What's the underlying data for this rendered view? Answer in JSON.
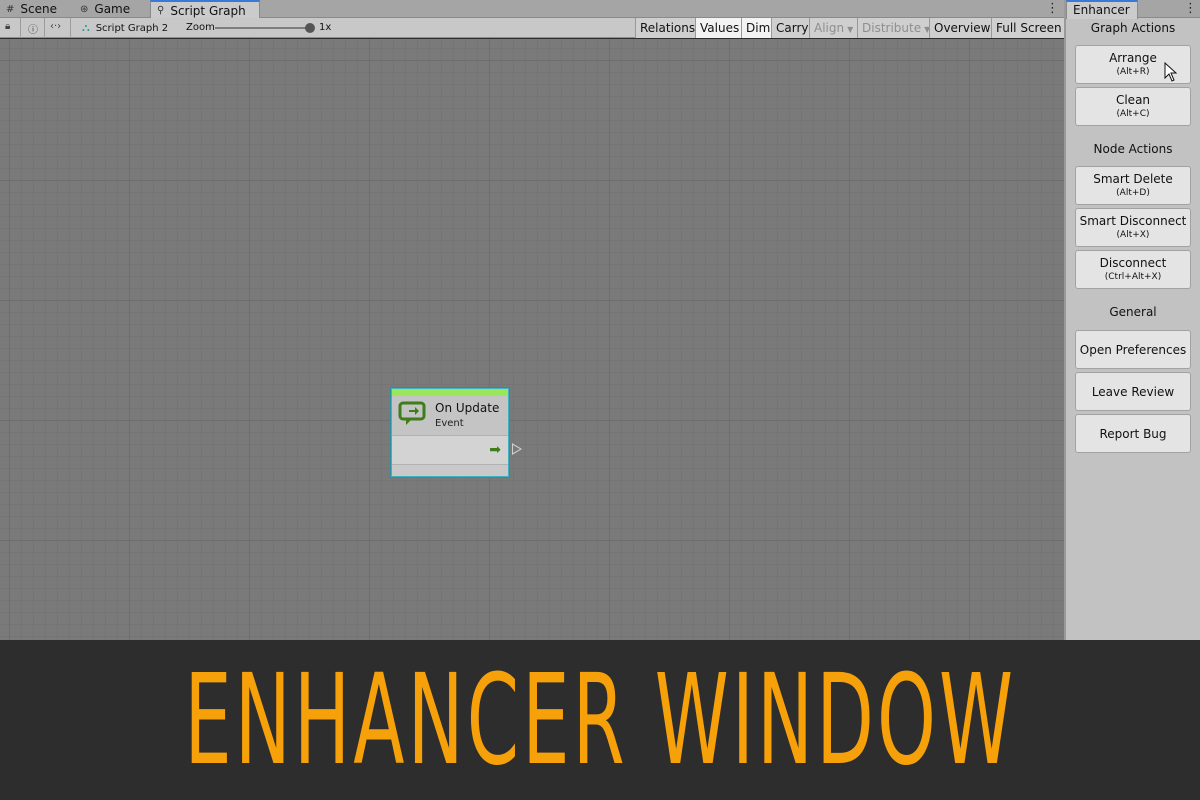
{
  "tabs": [
    {
      "label": "Scene",
      "icon": "grid-icon"
    },
    {
      "label": "Game",
      "icon": "gamepad-icon"
    },
    {
      "label": "Script Graph",
      "icon": "graph-icon",
      "active": true
    }
  ],
  "toolbar": {
    "breadcrumb": "Script Graph 2",
    "zoom_label": "Zoom",
    "zoom_value": "1x",
    "zoom_level": 1.0,
    "buttons": {
      "relations": "Relations",
      "values": "Values",
      "dim": "Dim",
      "carry": "Carry",
      "align": "Align",
      "distribute": "Distribute",
      "overview": "Overview",
      "full_screen": "Full Screen"
    }
  },
  "node": {
    "title": "On Update",
    "subtitle": "Event",
    "accent": "#9be65a"
  },
  "panel": {
    "tab": "Enhancer",
    "graph_actions": {
      "title": "Graph Actions",
      "arrange": {
        "label": "Arrange",
        "shortcut": "(Alt+R)"
      },
      "clean": {
        "label": "Clean",
        "shortcut": "(Alt+C)"
      }
    },
    "node_actions": {
      "title": "Node Actions",
      "smart_delete": {
        "label": "Smart Delete",
        "shortcut": "(Alt+D)"
      },
      "smart_disconnect": {
        "label": "Smart Disconnect",
        "shortcut": "(Alt+X)"
      },
      "disconnect": {
        "label": "Disconnect",
        "shortcut": "(Ctrl+Alt+X)"
      }
    },
    "general": {
      "title": "General",
      "open_preferences": "Open Preferences",
      "leave_review": "Leave Review",
      "report_bug": "Report Bug"
    }
  },
  "banner": {
    "text": "ENHANCER WINDOW",
    "color": "#f6a00a"
  }
}
